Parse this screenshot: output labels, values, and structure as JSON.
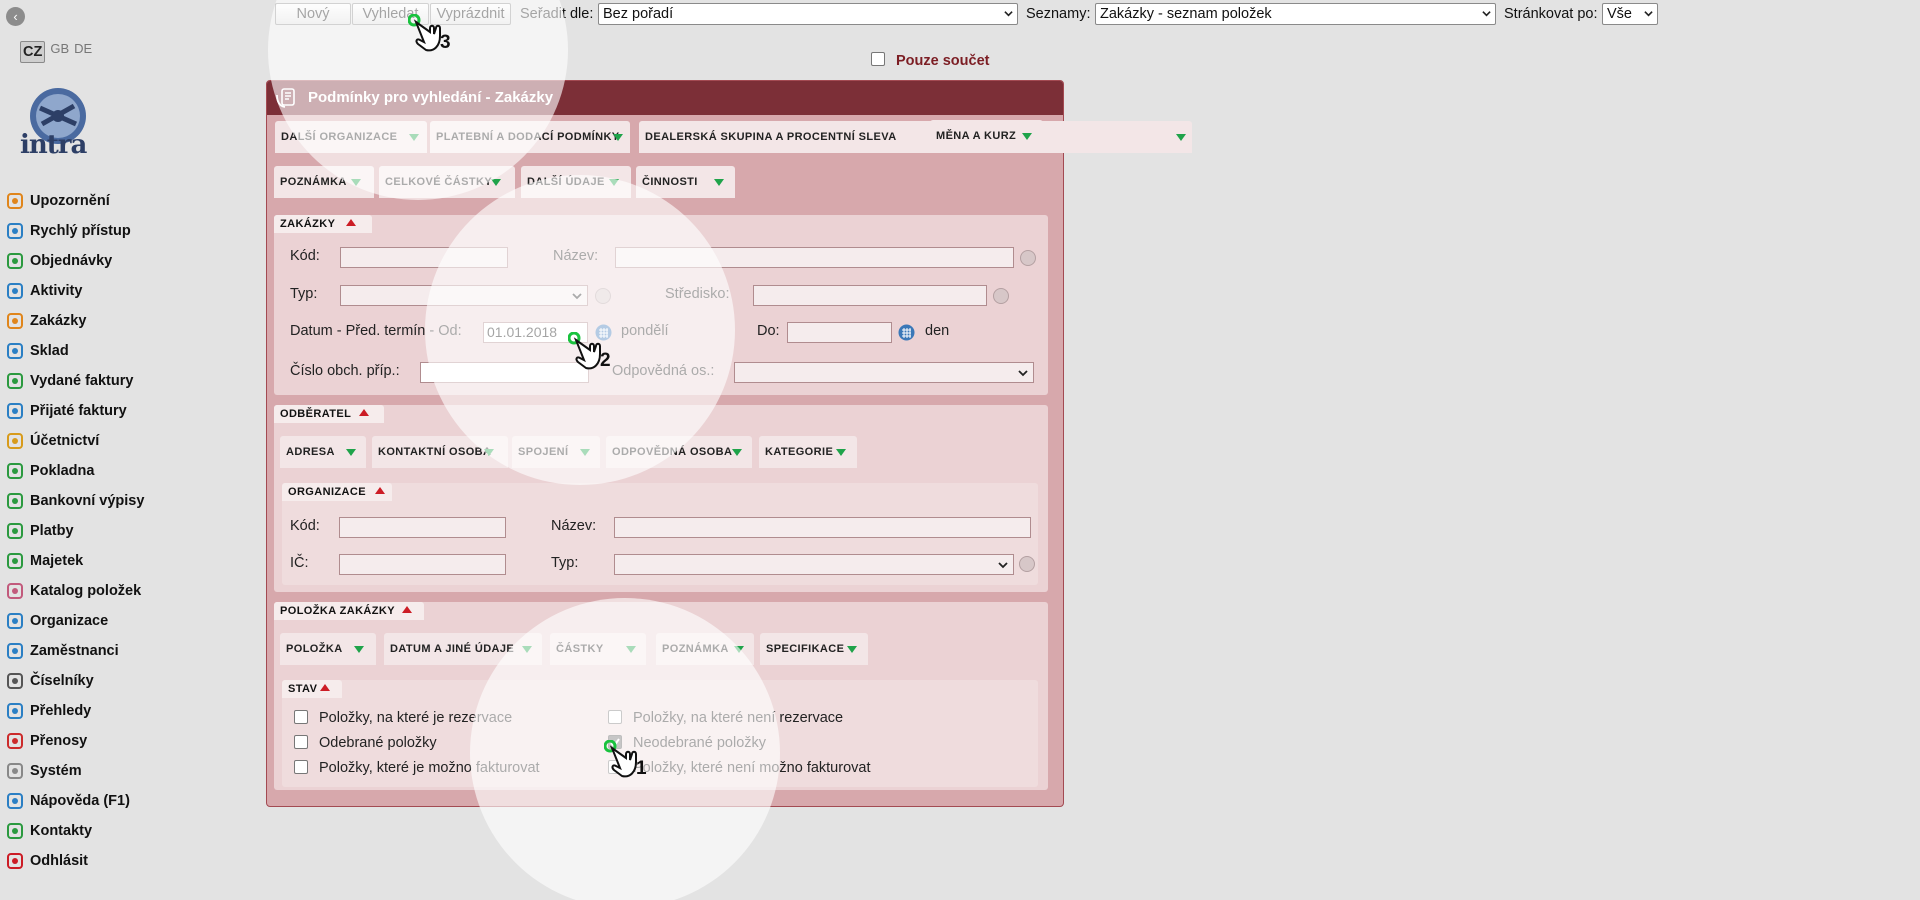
{
  "sidebar": {
    "collapse_glyph": "‹",
    "langs": [
      "CZ",
      "GB",
      "DE"
    ],
    "logo_text": "intra",
    "items": [
      {
        "label": "Upozornění",
        "icon": "bell-icon",
        "color": "#e0851b"
      },
      {
        "label": "Rychlý přístup",
        "icon": "tiles-icon",
        "color": "#2a7fc4"
      },
      {
        "label": "Objednávky",
        "icon": "cart-icon",
        "color": "#2b9a3f"
      },
      {
        "label": "Aktivity",
        "icon": "clock-icon",
        "color": "#2a7fc4"
      },
      {
        "label": "Zakázky",
        "icon": "order-icon",
        "color": "#e0851b"
      },
      {
        "label": "Sklad",
        "icon": "warehouse-icon",
        "color": "#2a7fc4"
      },
      {
        "label": "Vydané faktury",
        "icon": "invoice-out-icon",
        "color": "#2b9a3f"
      },
      {
        "label": "Přijaté faktury",
        "icon": "invoice-in-icon",
        "color": "#2a7fc4"
      },
      {
        "label": "Účetnictví",
        "icon": "ledger-icon",
        "color": "#d89b1b"
      },
      {
        "label": "Pokladna",
        "icon": "cashbox-icon",
        "color": "#2b9a3f"
      },
      {
        "label": "Bankovní výpisy",
        "icon": "bank-icon",
        "color": "#2b9a3f"
      },
      {
        "label": "Platby",
        "icon": "payment-icon",
        "color": "#2b9a3f"
      },
      {
        "label": "Majetek",
        "icon": "property-icon",
        "color": "#2b9a3f"
      },
      {
        "label": "Katalog položek",
        "icon": "tag-icon",
        "color": "#c25a7c"
      },
      {
        "label": "Organizace",
        "icon": "house-icon",
        "color": "#2a7fc4"
      },
      {
        "label": "Zaměstnanci",
        "icon": "employees-icon",
        "color": "#2a7fc4"
      },
      {
        "label": "Číselníky",
        "icon": "gear-icon",
        "color": "#555555"
      },
      {
        "label": "Přehledy",
        "icon": "list-icon",
        "color": "#2a7fc4"
      },
      {
        "label": "Přenosy",
        "icon": "transfer-icon",
        "color": "#cc2b2b"
      },
      {
        "label": "Systém",
        "icon": "wrench-icon",
        "color": "#888888"
      },
      {
        "label": "Nápověda (F1)",
        "icon": "help-icon",
        "color": "#2a7fc4"
      },
      {
        "label": "Kontakty",
        "icon": "at-icon",
        "color": "#2b9a3f"
      },
      {
        "label": "Odhlásit",
        "icon": "power-icon",
        "color": "#cc1c25"
      }
    ]
  },
  "toolbar": {
    "new_label": "Nový",
    "search_label": "Vyhledat",
    "clear_label": "Vyprázdnit",
    "sort_label": "Seřadit dle:",
    "sort_value": "Bez pořadí",
    "lists_label": "Seznamy:",
    "lists_value": "Zakázky - seznam položek",
    "paging_label": "Stránkovat po:",
    "paging_value": "Vše",
    "sum_only_label": "Pouze součet",
    "sum_only_checked": false
  },
  "panel": {
    "title": "Podmínky pro vyhledání - Zakázky",
    "top_tabs_row1": [
      "DALŠÍ ORGANIZACE",
      "PLATEBNÍ A DODACÍ PODMÍNKY",
      "DEALERSKÁ SKUPINA A PROCENTNÍ SLEVA",
      "MĚNA A KURZ"
    ],
    "top_tabs_row2": [
      "POZNÁMKA",
      "CELKOVÉ ČÁSTKY",
      "DALŠÍ ÚDAJE",
      "ČINNOSTI"
    ],
    "zakazky": {
      "header": "ZAKÁZKY",
      "kod_label": "Kód:",
      "nazev_label": "Název:",
      "typ_label": "Typ:",
      "stredisko_label": "Středisko:",
      "datum_label": "Datum - Před. termín - Od:",
      "datum_value": "01.01.2018",
      "datum_day": "pondělí",
      "do_label": "Do:",
      "do_day": "den",
      "cislo_label": "Číslo obch. příp.:",
      "odpovedna_label": "Odpovědná os.:"
    },
    "odberatel": {
      "header": "ODBĚRATEL",
      "tabs": [
        "ADRESA",
        "KONTAKTNÍ OSOBA",
        "SPOJENÍ",
        "ODPOVĚDNÁ OSOBA",
        "KATEGORIE"
      ],
      "org_header": "ORGANIZACE",
      "kod_label": "Kód:",
      "nazev_label": "Název:",
      "ic_label": "IČ:",
      "typ_label": "Typ:"
    },
    "polozka": {
      "header": "POLOŽKA ZAKÁZKY",
      "tabs": [
        "POLOŽKA",
        "DATUM A JINÉ ÚDAJE",
        "ČÁSTKY",
        "POZNÁMKA",
        "SPECIFIKACE"
      ],
      "stav_header": "STAV",
      "checks": [
        {
          "label": "Položky, na které je rezervace",
          "checked": false
        },
        {
          "label": "Položky, na které není rezervace",
          "checked": false
        },
        {
          "label": "Odebrané položky",
          "checked": false
        },
        {
          "label": "Neodebrané položky",
          "checked": true
        },
        {
          "label": "Položky, které je možno fakturovat",
          "checked": false
        },
        {
          "label": "Položky, které není možno fakturovat",
          "checked": false
        }
      ]
    }
  },
  "steps": [
    "1",
    "2",
    "3"
  ]
}
